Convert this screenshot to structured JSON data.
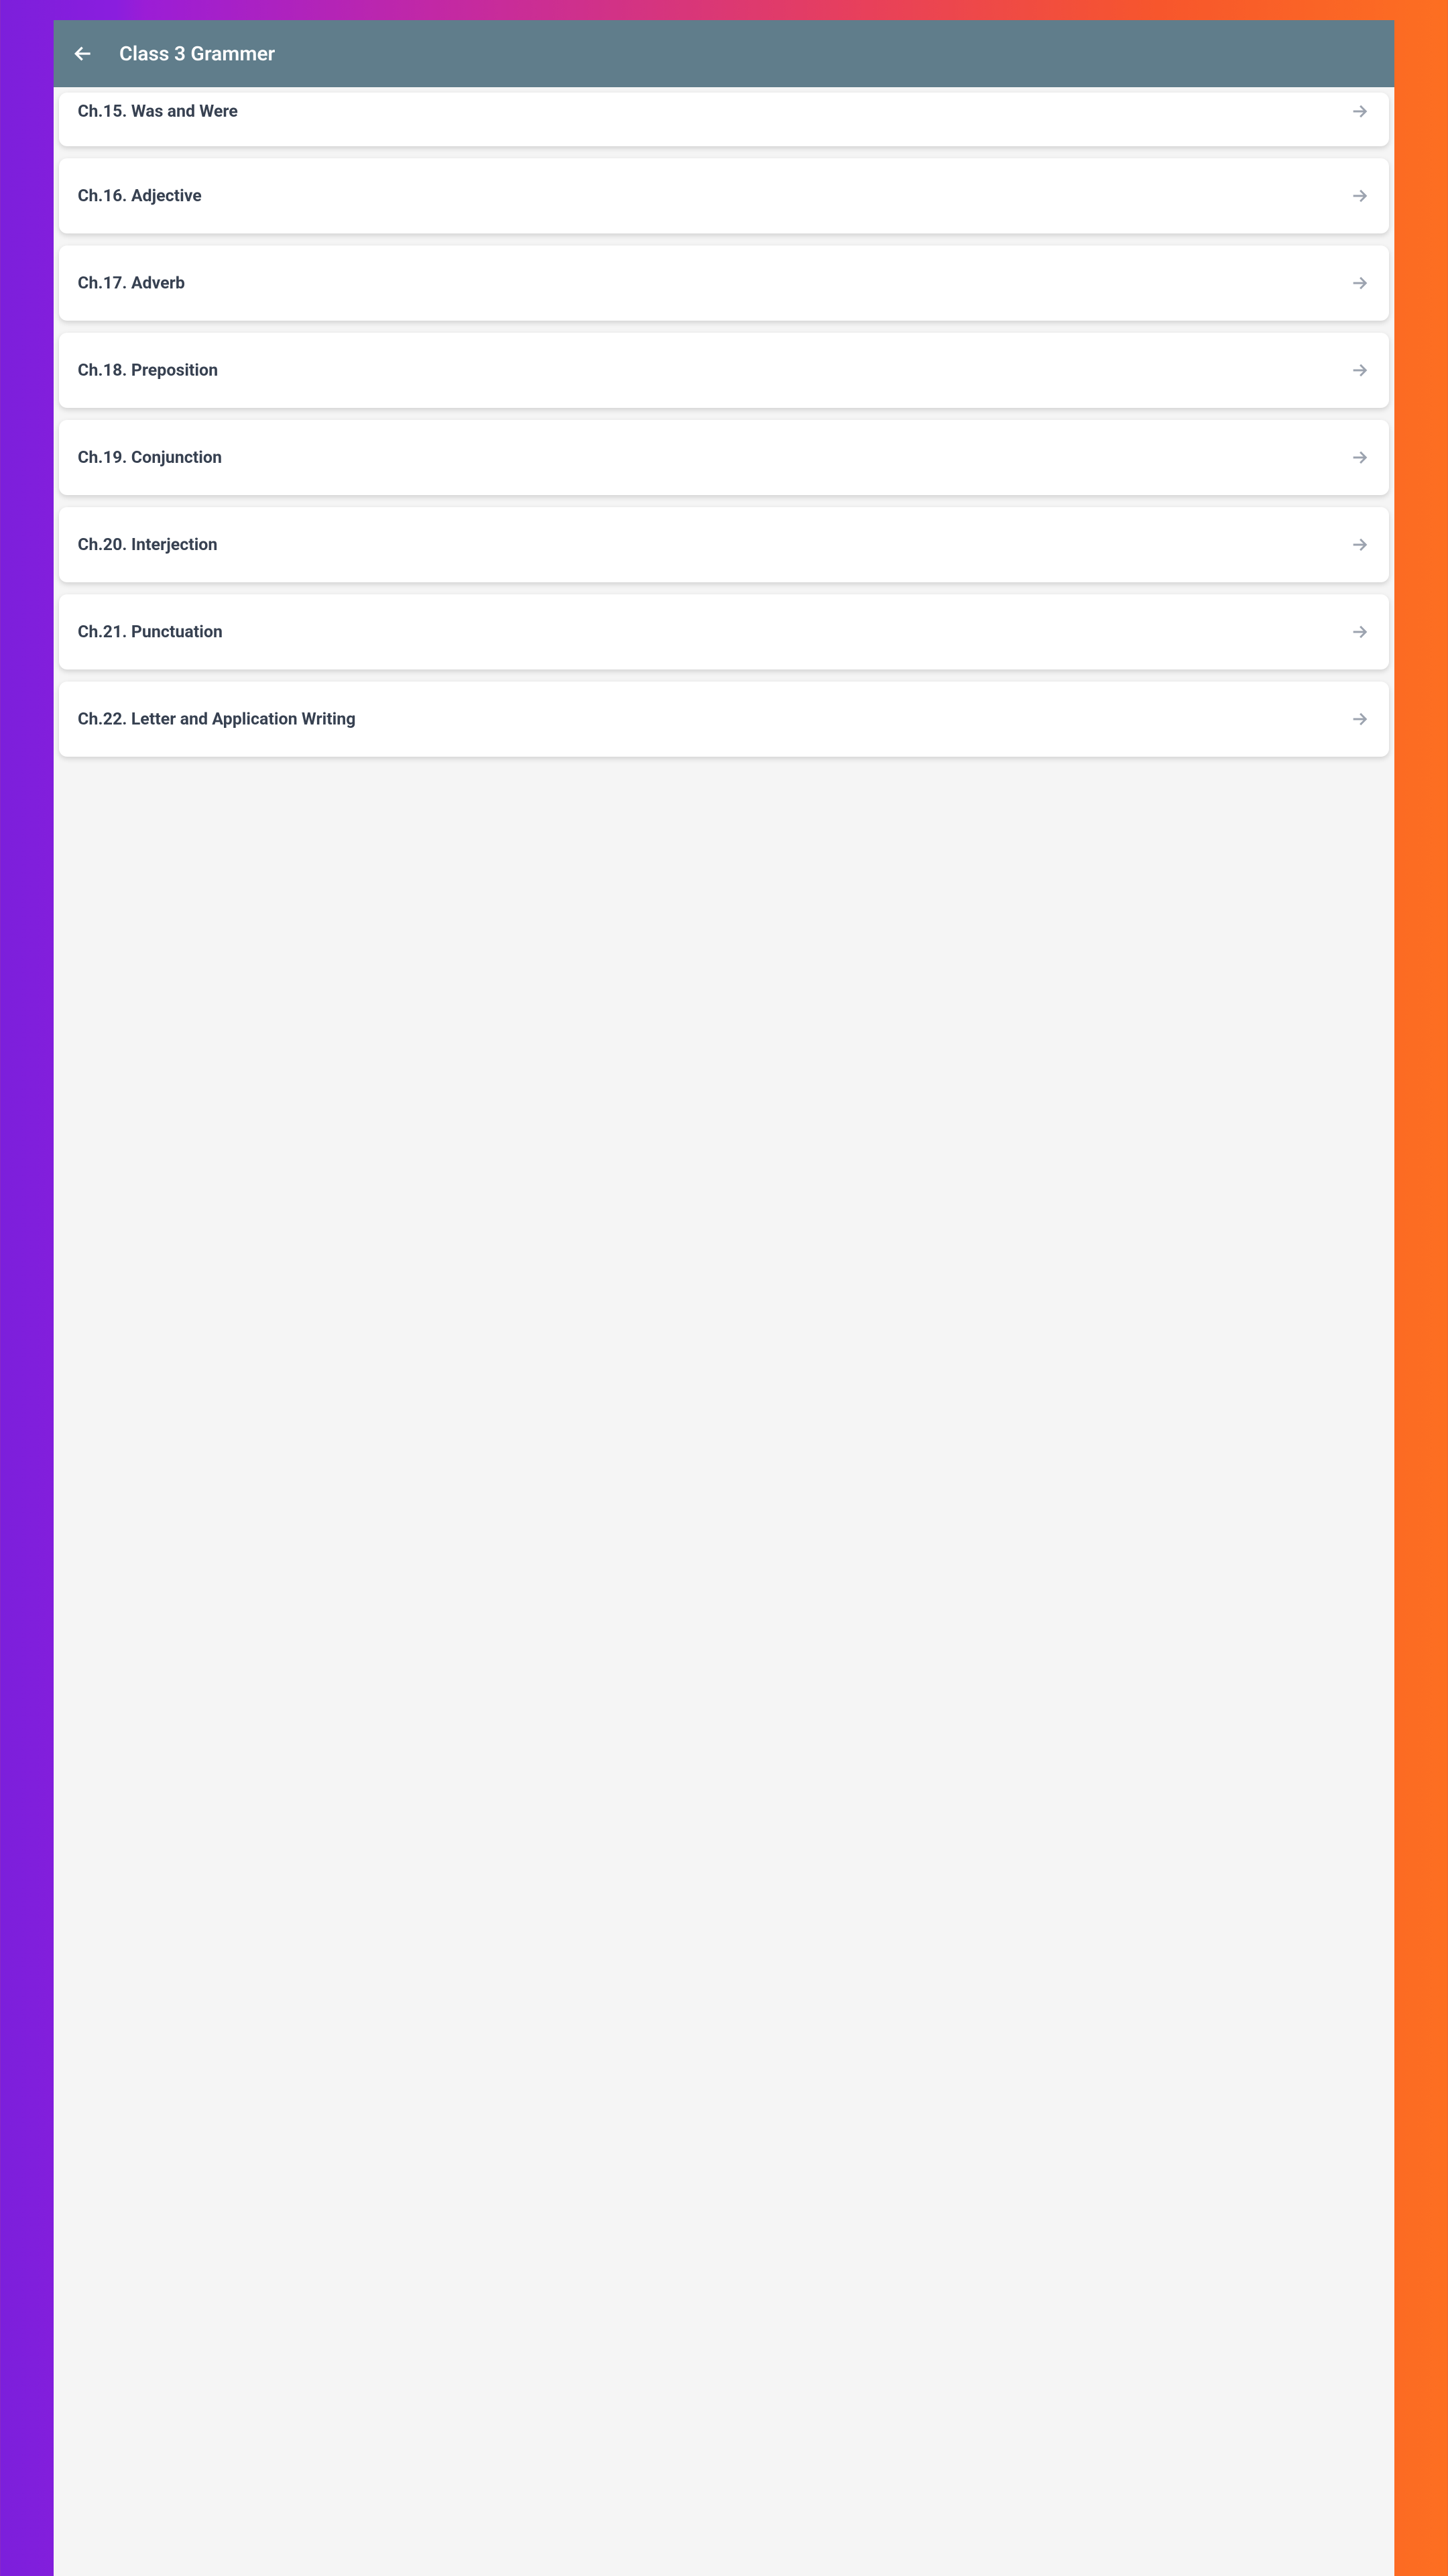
{
  "header": {
    "title": "Class 3 Grammer"
  },
  "chapters": [
    {
      "title": "Ch.15. Was and Were"
    },
    {
      "title": "Ch.16. Adjective"
    },
    {
      "title": "Ch.17. Adverb"
    },
    {
      "title": "Ch.18. Preposition"
    },
    {
      "title": "Ch.19. Conjunction"
    },
    {
      "title": "Ch.20. Interjection"
    },
    {
      "title": "Ch.21. Punctuation"
    },
    {
      "title": "Ch.22. Letter and Application Writing"
    }
  ]
}
